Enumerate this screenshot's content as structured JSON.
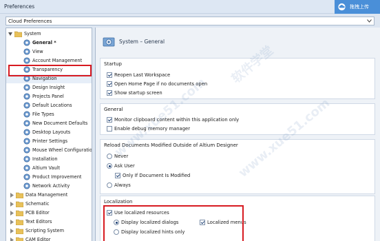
{
  "window": {
    "title": "Preferences",
    "upload_button": "拖拽上传"
  },
  "profile_dropdown": {
    "value": "Cloud Preferences"
  },
  "tree": {
    "root": "System",
    "children": [
      "General *",
      "View",
      "Account Management",
      "Transparency",
      "Navigation",
      "Design Insight",
      "Projects Panel",
      "Default Locations",
      "File Types",
      "New Document Defaults",
      "Desktop Layouts",
      "Printer Settings",
      "Mouse Wheel Configuratio",
      "Installation",
      "Altium Vault",
      "Product Improvement",
      "Network Activity"
    ],
    "folders": [
      "Data Management",
      "Schematic",
      "PCB Editor",
      "Text Editors",
      "Scripting System",
      "CAM Editor"
    ]
  },
  "page": {
    "title": "System – General"
  },
  "startup": {
    "title": "Startup",
    "options": [
      {
        "label": "Reopen Last Workspace",
        "checked": true
      },
      {
        "label": "Open Home Page if no documents open",
        "checked": true
      },
      {
        "label": "Show startup screen",
        "checked": true
      }
    ]
  },
  "general": {
    "title": "General",
    "options": [
      {
        "label": "Monitor clipboard content within this application only",
        "checked": true
      },
      {
        "label": "Enable debug memory manager",
        "checked": false
      }
    ]
  },
  "reload": {
    "title": "Reload Documents Modified Outside of Altium Designer",
    "never": "Never",
    "ask_user": "Ask User",
    "only_if_modified": "Only If Document Is Modified",
    "always": "Always",
    "selected": "Ask User",
    "only_if_modified_checked": true
  },
  "localization": {
    "title": "Localization",
    "use_localized": "Use localized resources",
    "use_localized_checked": true,
    "display_dialogs": "Display localized dialogs",
    "display_hints": "Display localized hints only",
    "localized_menus": "Localized menus",
    "localized_menus_checked": true,
    "selected": "Display localized dialogs"
  },
  "colors": {
    "highlight": "#d71920",
    "accent": "#4a8fd8"
  },
  "watermark": [
    "www.xue51.com",
    "软件学堂"
  ]
}
